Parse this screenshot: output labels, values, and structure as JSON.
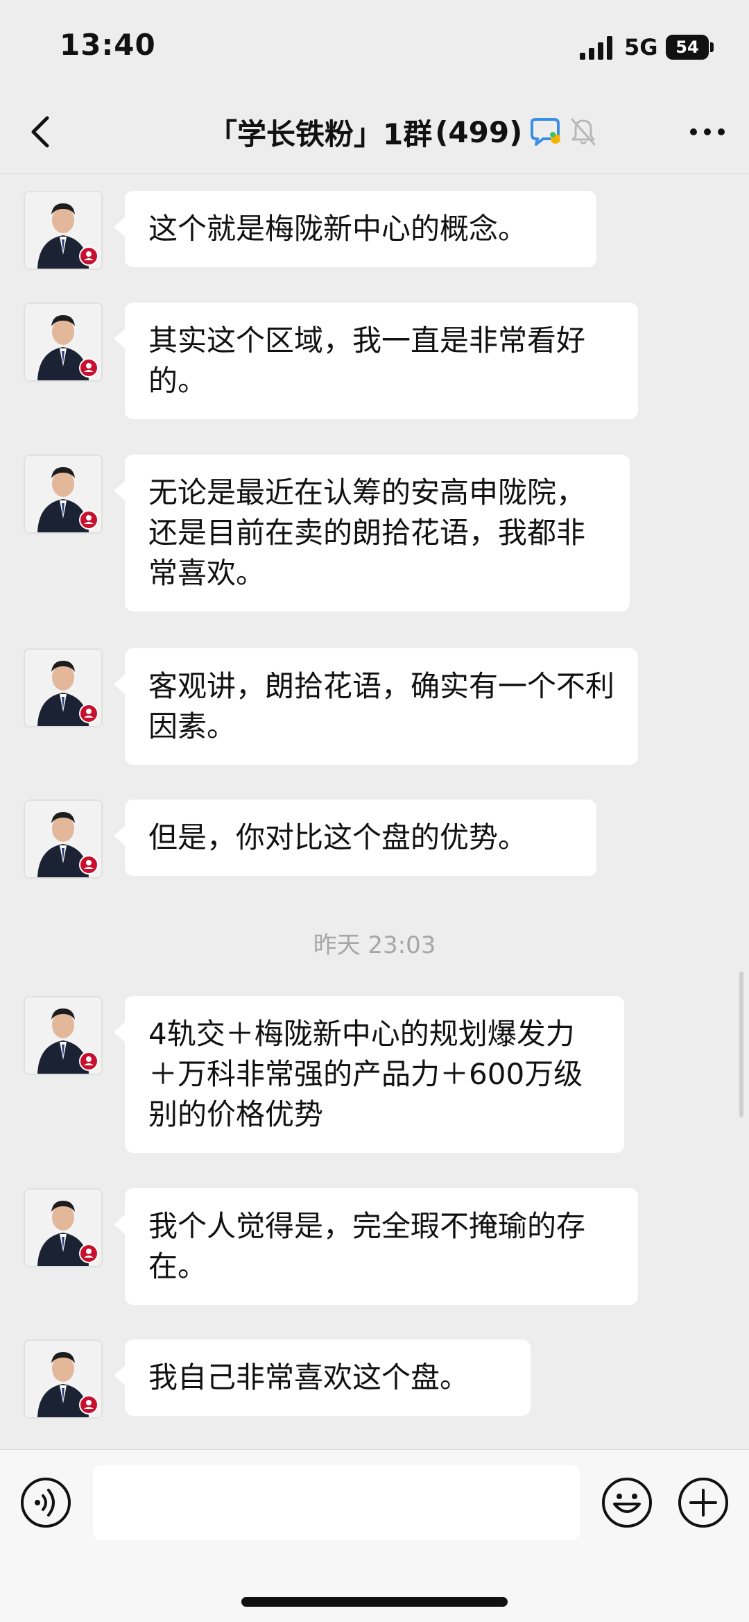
{
  "status_bar": {
    "time": "13:40",
    "network": "5G",
    "battery": "54"
  },
  "nav": {
    "title": "「学长铁粉」1群",
    "member_count": "(499)",
    "back_icon": "chevron-left-icon",
    "more_icon": "ellipsis-icon",
    "chat_icon": "chat-bubble-icon",
    "mute_icon": "bell-muted-icon"
  },
  "messages": [
    {
      "text": "这个就是梅陇新中心的概念。"
    },
    {
      "text": "其实这个区域，我一直是非常看好的。"
    },
    {
      "text": "无论是最近在认筹的安高申陇院，还是目前在卖的朗拾花语，我都非常喜欢。"
    },
    {
      "text": "客观讲，朗拾花语，确实有一个不利因素。"
    },
    {
      "text": "但是，你对比这个盘的优势。"
    },
    {
      "text": "4轨交＋梅陇新中心的规划爆发力＋万科非常强的产品力＋600万级别的价格优势"
    },
    {
      "text": "我个人觉得是，完全瑕不掩瑜的存在。"
    },
    {
      "text": "我自己非常喜欢这个盘。"
    }
  ],
  "timestamp": "昨天 23:03",
  "input_bar": {
    "placeholder": "",
    "voice_icon": "voice-icon",
    "emoji_icon": "emoji-icon",
    "add_icon": "plus-icon"
  },
  "colors": {
    "background": "#ededed",
    "bubble": "#ffffff",
    "timestamp": "#a6a6a6",
    "chat_icon_blue": "#3a8ee6"
  }
}
